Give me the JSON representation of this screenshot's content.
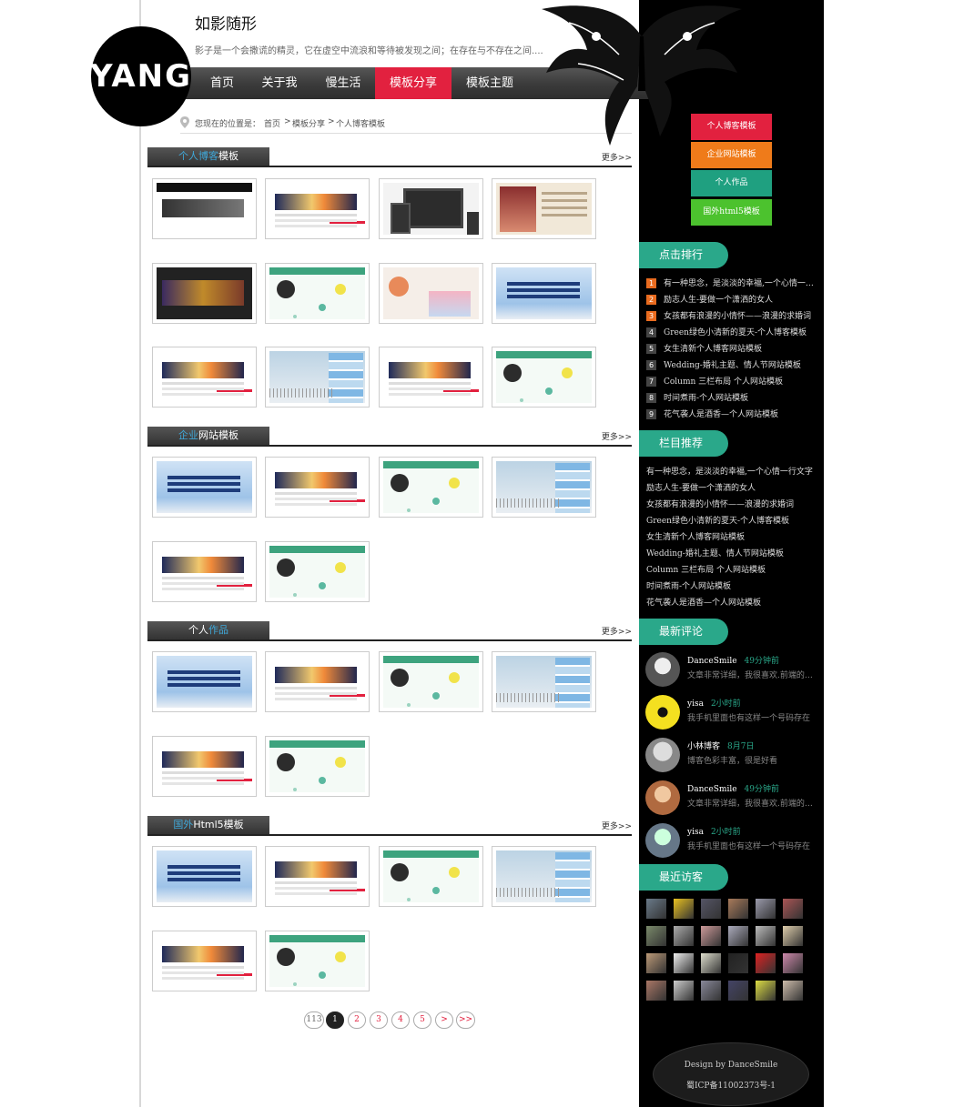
{
  "site": {
    "logo_text": "YANG",
    "title": "如影随形",
    "description": "影子是一个会撒谎的精灵，它在虚空中流浪和等待被发现之间；在存在与不存在之间...."
  },
  "nav": {
    "items": [
      {
        "label": "首页"
      },
      {
        "label": "关于我"
      },
      {
        "label": "慢生活"
      },
      {
        "label": "模板分享",
        "active": true
      },
      {
        "label": "模板主题"
      }
    ]
  },
  "breadcrumb": {
    "prefix": "您现在的位置是：",
    "items": [
      "首页",
      "模板分享",
      "个人博客模板"
    ],
    "separator": ">"
  },
  "sections": [
    {
      "title_plain_before": "",
      "title_highlight": "个人博客",
      "title_plain_after": "模板",
      "more": "更多>>"
    },
    {
      "title_plain_before": "",
      "title_highlight": "企业",
      "title_plain_after": "网站模板",
      "more": "更多>>"
    },
    {
      "title_plain_before": "个人",
      "title_highlight": "作品",
      "title_plain_after": "",
      "more": "更多>>"
    },
    {
      "title_plain_before": "",
      "title_highlight": "国外",
      "title_plain_after": "Html5模板",
      "more": "更多>>"
    }
  ],
  "pagination": {
    "total": "113",
    "current": "1",
    "pages": [
      "2",
      "3",
      "4",
      "5"
    ],
    "next": ">",
    "last": ">>"
  },
  "sidebar": {
    "categories": [
      {
        "label": "个人博客模板",
        "color": "#e2213f"
      },
      {
        "label": "企业网站模板",
        "color": "#ef7b1a"
      },
      {
        "label": "个人作品",
        "color": "#1fa080"
      },
      {
        "label": "国外html5模板",
        "color": "#4cc22e"
      }
    ],
    "ranking_title": "点击排行",
    "ranking": [
      {
        "num": "1",
        "text": "有一种思念，是淡淡的幸福,一个心情一行文字"
      },
      {
        "num": "2",
        "text": "励志人生-要做一个潇洒的女人"
      },
      {
        "num": "3",
        "text": "女孩都有浪漫的小情怀——浪漫的求婚词"
      },
      {
        "num": "4",
        "text": "Green绿色小清新的夏天-个人博客模板"
      },
      {
        "num": "5",
        "text": "女生清新个人博客网站模板"
      },
      {
        "num": "6",
        "text": "Wedding-婚礼主题、情人节网站模板"
      },
      {
        "num": "7",
        "text": "Column 三栏布局 个人网站模板"
      },
      {
        "num": "8",
        "text": "时间煮雨-个人网站模板"
      },
      {
        "num": "9",
        "text": "花气袭人是酒香—个人网站模板"
      }
    ],
    "rank_colors": [
      "#e96b1f",
      "#e96b1f",
      "#e96b1f",
      "#444",
      "#444",
      "#444",
      "#444",
      "#444",
      "#444"
    ],
    "recommend_title": "栏目推荐",
    "recommend": [
      "有一种思念，是淡淡的幸福,一个心情一行文字",
      "励志人生-要做一个潇洒的女人",
      "女孩都有浪漫的小情怀——浪漫的求婚词",
      "Green绿色小清新的夏天-个人博客模板",
      "女生清新个人博客网站模板",
      "Wedding-婚礼主题、情人节网站模板",
      "Column 三栏布局 个人网站模板",
      "时间煮雨-个人网站模板",
      "花气袭人是酒香—个人网站模板"
    ],
    "comments_title": "最新评论",
    "comments": [
      {
        "name": "DanceSmile",
        "time": "49分钟前",
        "text": "文章非常详细，我很喜欢.前端的工作其实..."
      },
      {
        "name": "yisa",
        "time": "2小时前",
        "text": "我手机里面也有这样一个号码存在"
      },
      {
        "name": "小林博客",
        "time": "8月7日",
        "text": "博客色彩丰富，很是好看"
      },
      {
        "name": "DanceSmile",
        "time": "49分钟前",
        "text": "文章非常详细，我很喜欢.前端的工作其实..."
      },
      {
        "name": "yisa",
        "time": "2小时前",
        "text": "我手机里面也有这样一个号码存在"
      }
    ],
    "visitors_title": "最近访客",
    "footer_design": "Design by DanceSmile",
    "footer_icp": "蜀ICP备11002373号-1"
  }
}
